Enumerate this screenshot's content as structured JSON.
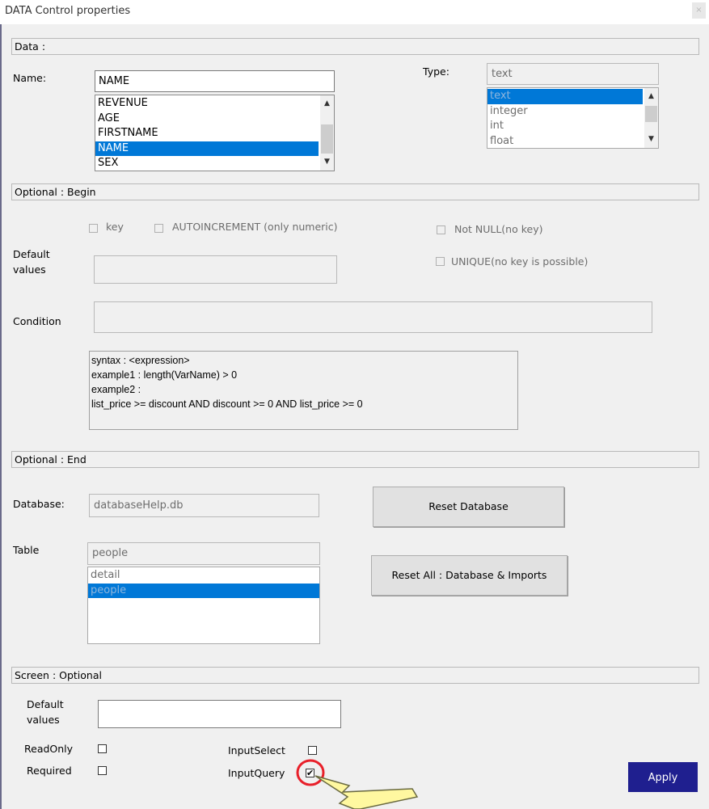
{
  "window": {
    "title": "DATA Control properties",
    "close_glyph": "×"
  },
  "sections": {
    "data": "Data :",
    "optional_begin": "Optional :  Begin",
    "optional_end": "Optional :  End",
    "screen": "Screen :  Optional"
  },
  "data": {
    "name_label": "Name:",
    "name_value": "NAME",
    "name_list": [
      "REVENUE",
      "AGE",
      "FIRSTNAME",
      "NAME",
      "SEX"
    ],
    "type_label": "Type:",
    "type_value": "text",
    "type_list": [
      "text",
      "integer",
      "int",
      "float"
    ]
  },
  "optional_begin": {
    "key_label": "key",
    "autoincrement_label": "AUTOINCREMENT (only numeric)",
    "not_null_label": "Not NULL(no key)",
    "unique_label": "UNIQUE(no key is possible)",
    "default_values_label_1": "Default",
    "default_values_label_2": "values",
    "condition_label": "Condition",
    "syntax_lines": [
      "syntax : <expression>",
      "example1 : length(VarName) > 0",
      "example2 :",
      "list_price >= discount AND  discount >= 0  AND list_price >= 0"
    ]
  },
  "optional_end": {
    "database_label": "Database:",
    "database_value": "databaseHelp.db",
    "reset_database_label": "Reset Database",
    "table_label": "Table",
    "table_value": "people",
    "table_list": [
      "detail",
      "people"
    ],
    "reset_all_label": "Reset All : Database & Imports"
  },
  "screen": {
    "default_values_label_1": "Default",
    "default_values_label_2": "values",
    "readonly_label": "ReadOnly",
    "required_label": "Required",
    "inputselect_label": "InputSelect",
    "inputquery_label": "InputQuery",
    "inputquery_checked": true,
    "check_glyph": "✔",
    "apply_label": "Apply"
  },
  "annotation": {
    "highlight_color": "#e8202a",
    "pointer_color": "#fff8a0"
  }
}
